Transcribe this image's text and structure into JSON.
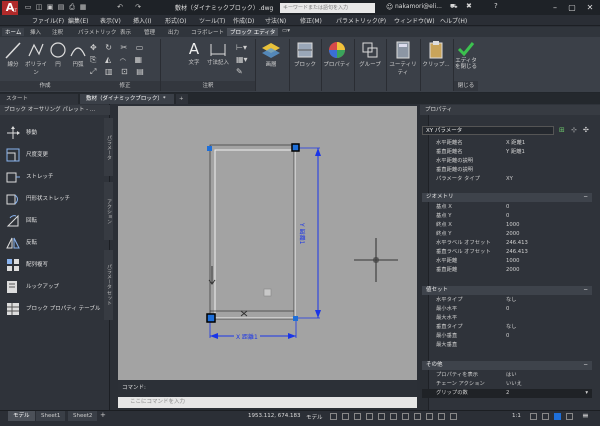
{
  "titlebar": {
    "logo": "A",
    "tag": "LT",
    "doc_title": "敷材（ダイナミックブロック）.dwg",
    "search_placeholder": "キーワードまたは語句を入力",
    "user": "nakamori@eli..."
  },
  "menu": [
    "ファイル(F)",
    "編集(E)",
    "表示(V)",
    "挿入(I)",
    "形式(O)",
    "ツール(T)",
    "作成(D)",
    "寸法(N)",
    "修正(M)",
    "パラメトリック(P)",
    "ウィンドウ(W)",
    "ヘルプ(H)"
  ],
  "ribbon_tabs": [
    "ホーム",
    "挿入",
    "注釈",
    "パラメトリック",
    "表示",
    "管理",
    "出力",
    "コラボレート",
    "ブロック エディタ"
  ],
  "ribbon": {
    "draw_tools": [
      "線分",
      "ポリライン",
      "円",
      "円弧"
    ],
    "panel_draw": "作成",
    "panel_modify": "修正",
    "text_tool": "文字",
    "dim_tool": "寸法記入",
    "panel_annotation": "注釈",
    "tools": [
      "画層",
      "ブロック",
      "プロパティ",
      "グループ",
      "ユーティリティ",
      "クリップ..."
    ],
    "close_editor": "エディタを閉じる",
    "panel_close": "閉じる"
  },
  "doc_tabs": [
    "スタート",
    "敷材（ダイナミックブロック）*"
  ],
  "palette": {
    "title": "ブロック オーサリング パレット - ...",
    "items": [
      "移動",
      "尺度変更",
      "ストレッチ",
      "円形状ストレッチ",
      "回転",
      "反転",
      "配列複写",
      "ルックアップ",
      "ブロック プロパティ テーブル"
    ],
    "side_tabs": [
      "パラメータ",
      "アクション",
      "パラメータ セット"
    ]
  },
  "drawing": {
    "x_dim": "X 距離1",
    "y_dim": "Y 距離1"
  },
  "command": {
    "label": "コマンド:",
    "placeholder": "ここにコマンドを入力"
  },
  "properties": {
    "title": "プロパティ",
    "selection": "XY パラメータ",
    "rows_top": [
      {
        "k": "水平距離名",
        "v": "X 距離1"
      },
      {
        "k": "垂直距離名",
        "v": "Y 距離1"
      },
      {
        "k": "水平距離の説明",
        "v": ""
      },
      {
        "k": "垂直距離の説明",
        "v": ""
      },
      {
        "k": "パラメータ タイプ",
        "v": "XY"
      }
    ],
    "geometry_title": "ジオメトリ",
    "geometry": [
      {
        "k": "基点 X",
        "v": "0"
      },
      {
        "k": "基点 Y",
        "v": "0"
      },
      {
        "k": "終点 X",
        "v": "1000"
      },
      {
        "k": "終点 Y",
        "v": "2000"
      },
      {
        "k": "水平ラベル オフセット",
        "v": "246.413"
      },
      {
        "k": "垂直ラベル オフセット",
        "v": "246.413"
      },
      {
        "k": "水平距離",
        "v": "1000"
      },
      {
        "k": "垂直距離",
        "v": "2000"
      }
    ],
    "values_title": "値セット",
    "values": [
      {
        "k": "水平タイプ",
        "v": "なし"
      },
      {
        "k": "最小水平",
        "v": "0"
      },
      {
        "k": "最大水平",
        "v": ""
      },
      {
        "k": "垂直タイプ",
        "v": "なし"
      },
      {
        "k": "最小垂直",
        "v": "0"
      },
      {
        "k": "最大垂直",
        "v": ""
      }
    ],
    "misc_title": "その他",
    "misc": [
      {
        "k": "プロパティを表示",
        "v": "はい"
      },
      {
        "k": "チェーン アクション",
        "v": "いいえ"
      },
      {
        "k": "グリップの数",
        "v": "2"
      }
    ]
  },
  "status": {
    "tabs": [
      "モデル",
      "Sheet1",
      "Sheet2"
    ],
    "coords": "1953.112, 674.183",
    "mode": "モデル",
    "scale": "1:1"
  },
  "colors": {
    "accent": "#1e6fd9",
    "dimension": "#1a35e8",
    "logo": "#b02a2a"
  }
}
